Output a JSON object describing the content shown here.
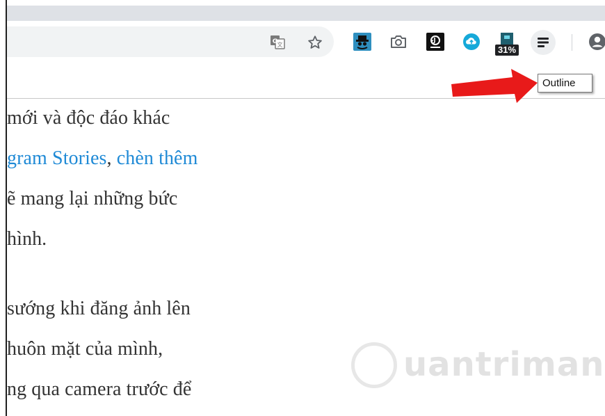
{
  "browser": {
    "tooltip": "Outline",
    "accent_arrow_color": "#e81a1a",
    "toolbar_icons": [
      "translate-icon",
      "bookmark-star-icon",
      "spy-extension-icon",
      "camera-extension-icon",
      "tiktok-extension-icon",
      "cloud-extension-icon",
      "meter-extension-icon",
      "outline-extension-icon",
      "profile-icon"
    ],
    "meter_badge": "31%"
  },
  "article": {
    "lines": [
      "mới và độc đáo khác",
      "gram Stories, chèn thêm",
      "ẽ mang lại những bức",
      "hình.",
      "",
      "sướng khi đăng ảnh lên",
      "huôn mặt của mình,",
      "ng qua camera trước để"
    ],
    "link_text_1": "gram Stories",
    "link_text_2": "chèn thêm"
  },
  "watermark": {
    "text": "uantrimang"
  }
}
